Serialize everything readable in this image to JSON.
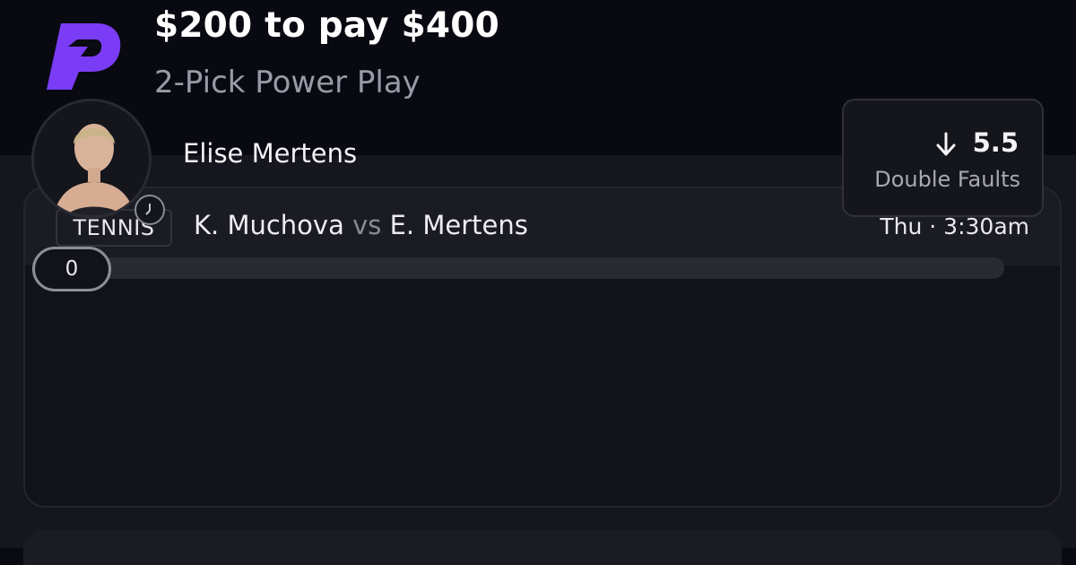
{
  "header": {
    "headline": "$200 to pay $400",
    "subline": "2-Pick Power Play",
    "logo_icon": "prizepicks-logo-icon",
    "brand_color": "#7b3cf5"
  },
  "pick": {
    "sport": "TENNIS",
    "team_a": "K. Muchova",
    "vs": "vs",
    "team_b": "E. Mertens",
    "time": "Thu · 3:30am",
    "player_name": "Elise Mertens",
    "direction_icon": "arrow-down-icon",
    "line": "5.5",
    "stat": "Double Faults",
    "current_value": "0",
    "progress_fraction": 0
  }
}
